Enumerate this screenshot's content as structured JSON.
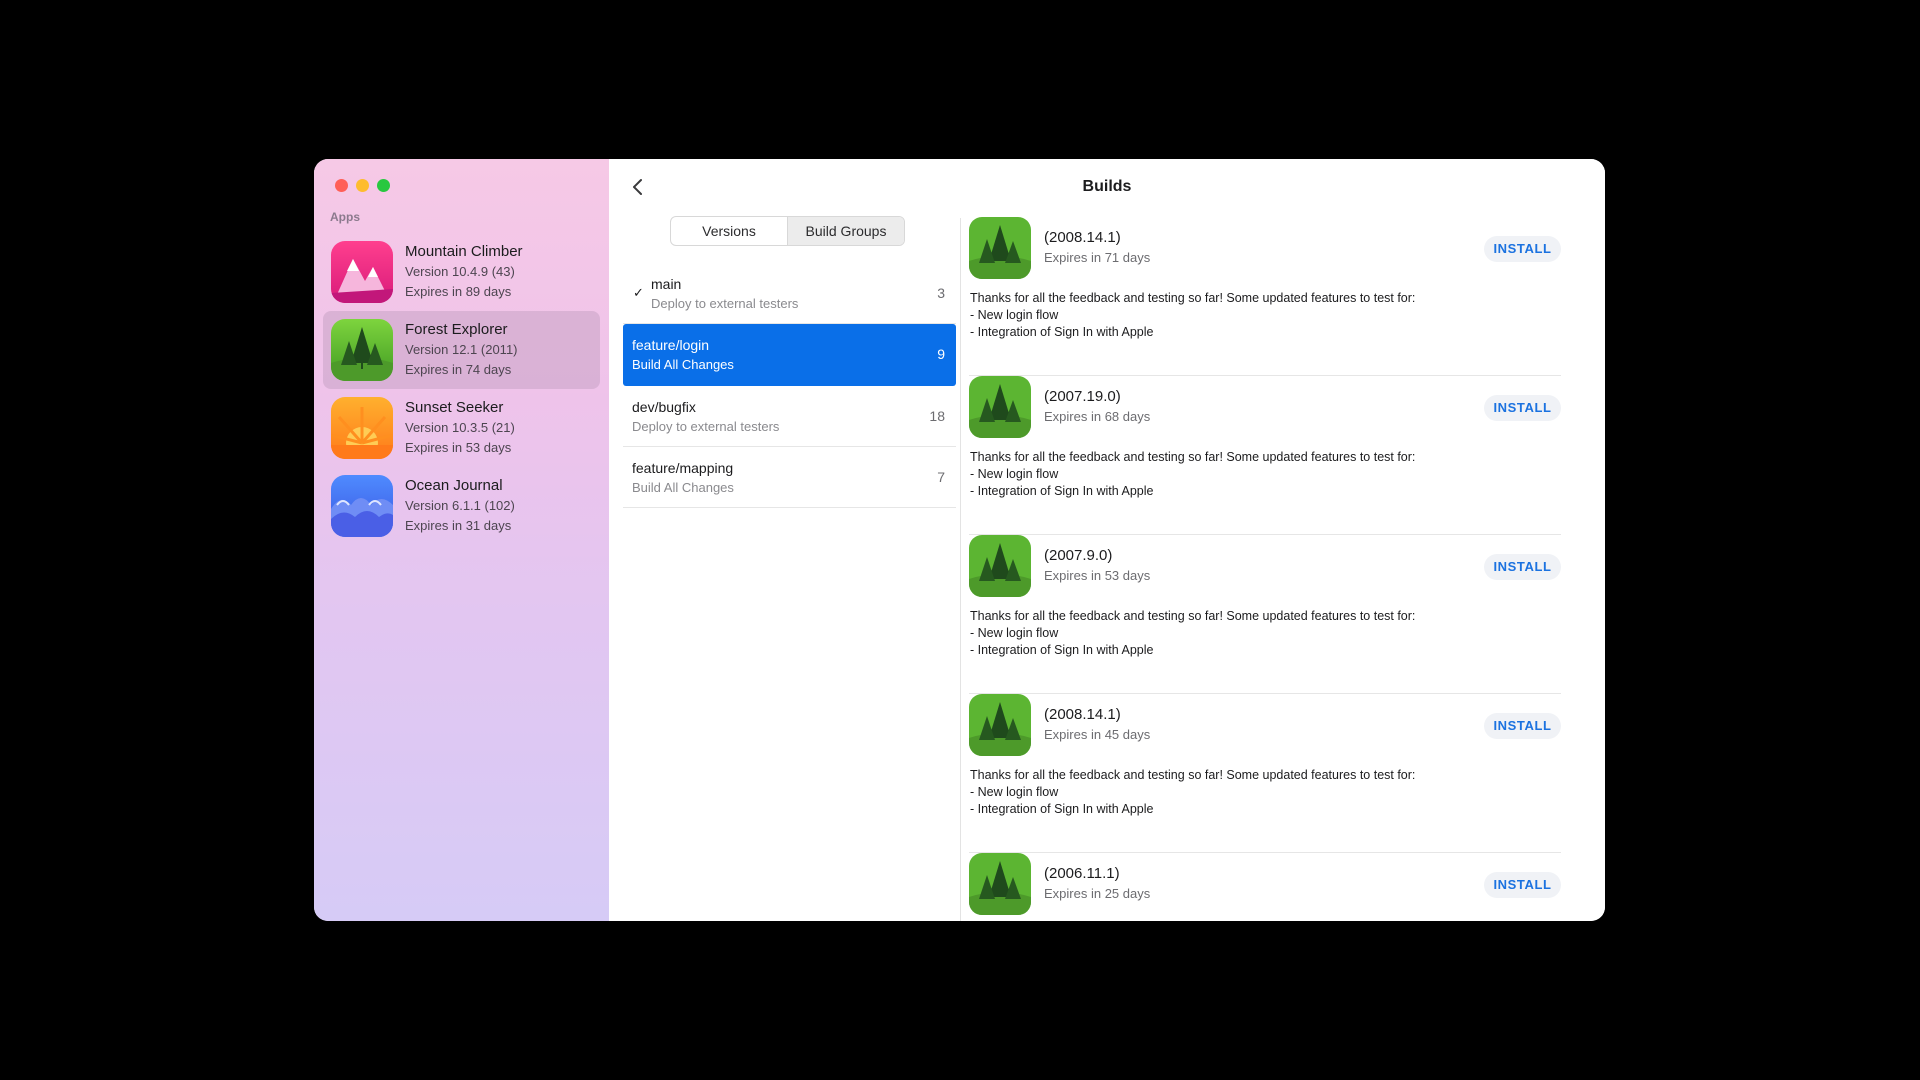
{
  "window": {
    "traffic_colors": [
      "#ff5f57",
      "#febc2e",
      "#28c840"
    ]
  },
  "sidebar": {
    "section_label": "Apps",
    "apps": [
      {
        "name": "Mountain Climber",
        "version": "Version 10.4.9 (43)",
        "expires": "Expires in 89 days",
        "icon": "mountain-icon",
        "selected": false
      },
      {
        "name": "Forest Explorer",
        "version": "Version 12.1 (2011)",
        "expires": "Expires in 74 days",
        "icon": "forest-icon",
        "selected": true
      },
      {
        "name": "Sunset Seeker",
        "version": "Version 10.3.5 (21)",
        "expires": "Expires in 53 days",
        "icon": "sunset-icon",
        "selected": false
      },
      {
        "name": "Ocean Journal",
        "version": "Version 6.1.1 (102)",
        "expires": "Expires in 31 days",
        "icon": "ocean-icon",
        "selected": false
      }
    ]
  },
  "header": {
    "title": "Builds"
  },
  "segments": [
    {
      "label": "Versions",
      "active": false
    },
    {
      "label": "Build Groups",
      "active": true
    }
  ],
  "build_groups": [
    {
      "name": "main",
      "desc": "Deploy to external testers",
      "count": "3",
      "checked": true,
      "selected": false
    },
    {
      "name": "feature/login",
      "desc": "Build All Changes",
      "count": "9",
      "checked": false,
      "selected": true
    },
    {
      "name": "dev/bugfix",
      "desc": "Deploy to external testers",
      "count": "18",
      "checked": false,
      "selected": false
    },
    {
      "name": "feature/mapping",
      "desc": "Build All Changes",
      "count": "7",
      "checked": false,
      "selected": false
    }
  ],
  "builds": [
    {
      "version": "(2008.14.1)",
      "expires": "Expires in 71 days",
      "install": "INSTALL",
      "notes": "Thanks for all the feedback and testing so far! Some updated features to test for:\n- New login flow\n- Integration of Sign In with Apple"
    },
    {
      "version": "(2007.19.0)",
      "expires": "Expires in 68 days",
      "install": "INSTALL",
      "notes": "Thanks for all the feedback and testing so far! Some updated features to test for:\n- New login flow\n- Integration of Sign In with Apple"
    },
    {
      "version": "(2007.9.0)",
      "expires": "Expires in 53 days",
      "install": "INSTALL",
      "notes": "Thanks for all the feedback and testing so far! Some updated features to test for:\n- New login flow\n- Integration of Sign In with Apple"
    },
    {
      "version": "(2008.14.1)",
      "expires": "Expires in 45 days",
      "install": "INSTALL",
      "notes": "Thanks for all the feedback and testing so far! Some updated features to test for:\n- New login flow\n- Integration of Sign In with Apple"
    },
    {
      "version": "(2006.11.1)",
      "expires": "Expires in 25 days",
      "install": "INSTALL",
      "notes": ""
    }
  ],
  "colors": {
    "accent": "#0a6fe8",
    "install_text": "#1b72e0"
  }
}
